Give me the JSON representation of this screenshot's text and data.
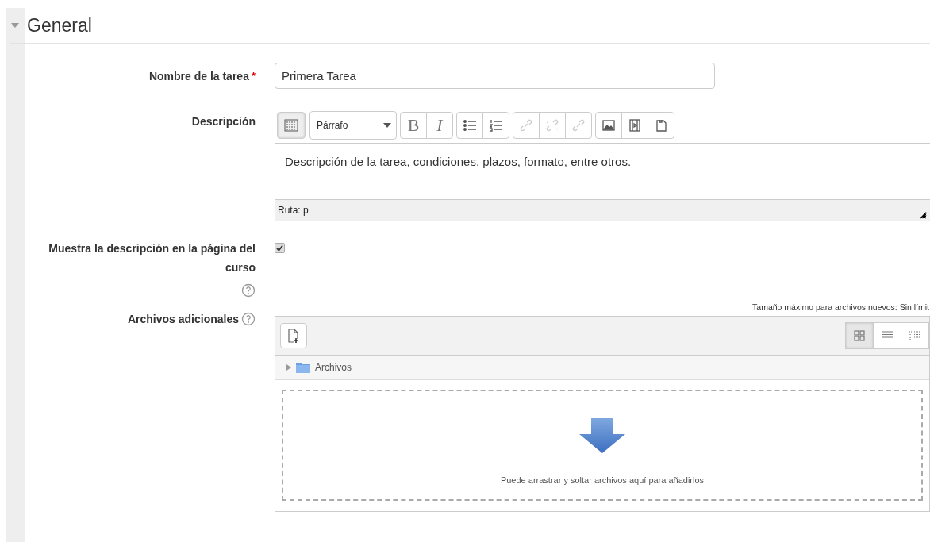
{
  "section": {
    "title": "General",
    "expanded": true
  },
  "name_field": {
    "label": "Nombre de la tarea",
    "required": true,
    "required_mark": "*",
    "value": "Primera Tarea"
  },
  "description": {
    "label": "Descripción",
    "format": "Párrafo",
    "toolbar": [
      {
        "buttons": [
          {
            "kind": "toggle",
            "disabled": false
          }
        ]
      },
      {
        "buttons": [
          {
            "kind": "bold",
            "label": "B",
            "disabled": false
          },
          {
            "kind": "italic",
            "label": "I",
            "disabled": false
          }
        ]
      },
      {
        "buttons": [
          {
            "kind": "bullets",
            "disabled": false
          },
          {
            "kind": "numbers",
            "disabled": false
          }
        ]
      },
      {
        "buttons": [
          {
            "kind": "link",
            "disabled": true
          },
          {
            "kind": "unlink",
            "disabled": true
          },
          {
            "kind": "link",
            "disabled": true
          }
        ]
      },
      {
        "buttons": [
          {
            "kind": "image",
            "disabled": false
          },
          {
            "kind": "media",
            "disabled": false
          },
          {
            "kind": "paste",
            "disabled": false
          }
        ]
      }
    ],
    "text": "Descripción de la tarea, condiciones, plazos, formato, entre otros.",
    "path": "Ruta: p"
  },
  "show_description": {
    "label": "Muestra la descripción en la página del curso",
    "checked": true
  },
  "files": {
    "label": "Archivos adicionales",
    "max_size": "Tamaño máximo para archivos nuevos: Sin límit",
    "views": [
      {
        "kind": "icons",
        "selected": true
      },
      {
        "kind": "list",
        "selected": false
      },
      {
        "kind": "tree",
        "selected": false
      }
    ],
    "folder": "Archivos",
    "drop_hint": "Puede arrastrar y soltar archivos aquí para añadirlos"
  }
}
